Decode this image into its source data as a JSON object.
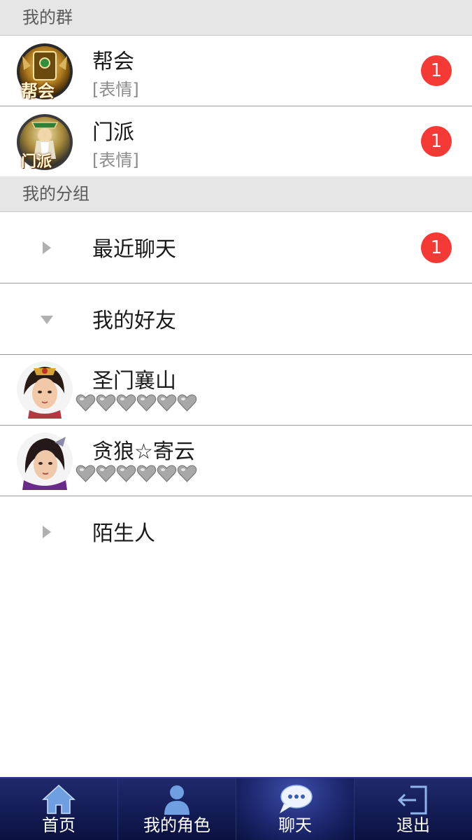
{
  "sections": {
    "groups_header": "我的群",
    "folders_header": "我的分组"
  },
  "groups": [
    {
      "name": "帮会",
      "last_message": "[表情]",
      "unread": "1",
      "avatar_text": "帮会"
    },
    {
      "name": "门派",
      "last_message": "[表情]",
      "unread": "1",
      "avatar_text": "门派"
    }
  ],
  "folders": {
    "recent": {
      "label": "最近聊天",
      "unread": "1"
    },
    "friends": {
      "label": "我的好友"
    },
    "strangers": {
      "label": "陌生人"
    }
  },
  "friends": [
    {
      "name": "圣门襄山",
      "hearts": 6
    },
    {
      "name": "贪狼☆寄云",
      "hearts": 6
    }
  ],
  "tabbar": {
    "home": "首页",
    "my_role": "我的角色",
    "chat": "聊天",
    "logout": "退出"
  },
  "colors": {
    "badge": "#f53a36",
    "tabbar": "#1f2a6e",
    "section_header": "#e6e6e6"
  },
  "icons": {
    "home": "home-icon",
    "my_role": "person-icon",
    "chat": "chat-bubble-icon",
    "logout": "logout-icon"
  }
}
